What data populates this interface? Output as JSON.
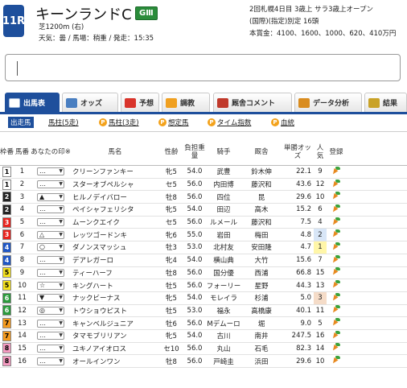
{
  "race": {
    "number": "11R",
    "name": "キーンランドC",
    "grade": "GⅢ",
    "distance": "芝1200m (右)",
    "conditions": "天気：曇 / 馬場：稍重 / 発走：15:35",
    "meeting": "2回札幌4日目  3歳上  サラ3歳上オープン",
    "class": "(国際)(指定)別定  16頭",
    "prize": "本賞金：4100、1600、1000、620、410万円"
  },
  "tabs": [
    {
      "label": "出馬表",
      "icon": "table-icon",
      "color": "#ffffff"
    },
    {
      "label": "オッズ",
      "icon": "odds-icon",
      "color": "#4a7fc1"
    },
    {
      "label": "予想",
      "icon": "target-icon",
      "color": "#d9342b"
    },
    {
      "label": "調教",
      "icon": "training-icon",
      "color": "#f0a020"
    },
    {
      "label": "厩舎コメント",
      "icon": "comment-icon",
      "color": "#c0392b"
    },
    {
      "label": "データ分析",
      "icon": "analysis-icon",
      "color": "#d98c1f"
    },
    {
      "label": "結果",
      "icon": "result-icon",
      "color": "#c9a227"
    }
  ],
  "subnav": [
    {
      "label": "出走馬",
      "p": false,
      "active": true
    },
    {
      "label": "馬柱(5走)",
      "p": false,
      "active": false
    },
    {
      "label": "馬柱(3走)",
      "p": true,
      "active": false
    },
    {
      "label": "想定馬",
      "p": true,
      "active": false
    },
    {
      "label": "タイム指数",
      "p": true,
      "active": false
    },
    {
      "label": "血統",
      "p": true,
      "active": false
    }
  ],
  "p_badge": "P",
  "columns": {
    "waku": "枠番",
    "umaban": "馬番",
    "mark": "あなたの印※",
    "horse": "馬名",
    "sex_age": "性齢",
    "weight": "負担重量",
    "jockey": "騎手",
    "trainer": "厩舎",
    "odds": "単勝オッズ",
    "pop": "人気",
    "register": "登録"
  },
  "waku_colors": {
    "1": {
      "bg": "#ffffff",
      "fg": "#000000"
    },
    "2": {
      "bg": "#222222",
      "fg": "#ffffff"
    },
    "3": {
      "bg": "#e8231e",
      "fg": "#ffffff"
    },
    "4": {
      "bg": "#1f56c5",
      "fg": "#ffffff"
    },
    "5": {
      "bg": "#f5e21d",
      "fg": "#000000"
    },
    "6": {
      "bg": "#2c9a3c",
      "fg": "#ffffff"
    },
    "7": {
      "bg": "#f49a1e",
      "fg": "#000000"
    },
    "8": {
      "bg": "#f49ac0",
      "fg": "#000000"
    }
  },
  "horses": [
    {
      "waku": "1",
      "umaban": "1",
      "mark": "…",
      "name": "クリーンファンキー",
      "sex_age": "牝5",
      "weight": "54.0",
      "jockey": "武豊",
      "trainer": "鈴木伸",
      "odds": "22.1",
      "pop": "9"
    },
    {
      "waku": "1",
      "umaban": "2",
      "mark": "…",
      "name": "スターオブペルシャ",
      "sex_age": "セ5",
      "weight": "56.0",
      "jockey": "内田博",
      "trainer": "藤沢和",
      "odds": "43.6",
      "pop": "12"
    },
    {
      "waku": "2",
      "umaban": "3",
      "mark": "▲",
      "name": "ヒルノデイバロー",
      "sex_age": "牡8",
      "weight": "56.0",
      "jockey": "四位",
      "trainer": "昆",
      "odds": "29.6",
      "pop": "10"
    },
    {
      "waku": "2",
      "umaban": "4",
      "mark": "…",
      "name": "ペイシャフェリシタ",
      "sex_age": "牝5",
      "weight": "54.0",
      "jockey": "田辺",
      "trainer": "高木",
      "odds": "15.2",
      "pop": "6"
    },
    {
      "waku": "3",
      "umaban": "5",
      "mark": "…",
      "name": "ムーンクエイク",
      "sex_age": "セ5",
      "weight": "56.0",
      "jockey": "ルメール",
      "trainer": "藤沢和",
      "odds": "7.5",
      "pop": "4"
    },
    {
      "waku": "3",
      "umaban": "6",
      "mark": "△",
      "name": "レッツゴードンキ",
      "sex_age": "牝6",
      "weight": "55.0",
      "jockey": "岩田",
      "trainer": "梅田",
      "odds": "4.8",
      "pop": "2"
    },
    {
      "waku": "4",
      "umaban": "7",
      "mark": "○",
      "name": "ダノンスマッシュ",
      "sex_age": "牡3",
      "weight": "53.0",
      "jockey": "北村友",
      "trainer": "安田隆",
      "odds": "4.7",
      "pop": "1"
    },
    {
      "waku": "4",
      "umaban": "8",
      "mark": "…",
      "name": "デアレガーロ",
      "sex_age": "牝4",
      "weight": "54.0",
      "jockey": "横山典",
      "trainer": "大竹",
      "odds": "15.6",
      "pop": "7"
    },
    {
      "waku": "5",
      "umaban": "9",
      "mark": "…",
      "name": "ティーハーフ",
      "sex_age": "牡8",
      "weight": "56.0",
      "jockey": "国分優",
      "trainer": "西浦",
      "odds": "66.8",
      "pop": "15"
    },
    {
      "waku": "5",
      "umaban": "10",
      "mark": "☆",
      "name": "キングハート",
      "sex_age": "牡5",
      "weight": "56.0",
      "jockey": "フォーリー",
      "trainer": "星野",
      "odds": "44.3",
      "pop": "13"
    },
    {
      "waku": "6",
      "umaban": "11",
      "mark": "▼",
      "name": "ナックビーナス",
      "sex_age": "牝5",
      "weight": "54.0",
      "jockey": "モレイラ",
      "trainer": "杉浦",
      "odds": "5.0",
      "pop": "3"
    },
    {
      "waku": "6",
      "umaban": "12",
      "mark": "◎",
      "name": "トウショウピスト",
      "sex_age": "牡5",
      "weight": "53.0",
      "jockey": "福永",
      "trainer": "高橋康",
      "odds": "40.1",
      "pop": "11"
    },
    {
      "waku": "7",
      "umaban": "13",
      "mark": "…",
      "name": "キャンベルジュニア",
      "sex_age": "牡6",
      "weight": "56.0",
      "jockey": "Mデムーロ",
      "trainer": "堀",
      "odds": "9.0",
      "pop": "5"
    },
    {
      "waku": "7",
      "umaban": "14",
      "mark": "…",
      "name": "タマモブリリアン",
      "sex_age": "牝5",
      "weight": "54.0",
      "jockey": "古川",
      "trainer": "南井",
      "odds": "247.5",
      "pop": "16"
    },
    {
      "waku": "8",
      "umaban": "15",
      "mark": "…",
      "name": "ユキノアイオロス",
      "sex_age": "セ10",
      "weight": "56.0",
      "jockey": "丸山",
      "trainer": "石毛",
      "odds": "82.3",
      "pop": "14"
    },
    {
      "waku": "8",
      "umaban": "16",
      "mark": "…",
      "name": "オールインワン",
      "sex_age": "牡8",
      "weight": "56.0",
      "jockey": "戸崎圭",
      "trainer": "浜田",
      "odds": "29.6",
      "pop": "10"
    }
  ]
}
